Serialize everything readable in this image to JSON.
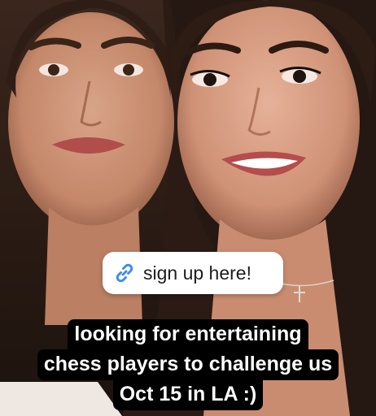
{
  "story": {
    "link_sticker": {
      "icon": "link-icon",
      "label": "sign up here!"
    },
    "caption": {
      "lines": [
        "looking for entertaining",
        "chess players to challenge us",
        "Oct 15 in LA :)"
      ]
    }
  },
  "colors": {
    "sticker_bg": "#ffffff",
    "link_icon": "#3d8ee6",
    "caption_bg": "#000000",
    "caption_text": "#ffffff"
  }
}
